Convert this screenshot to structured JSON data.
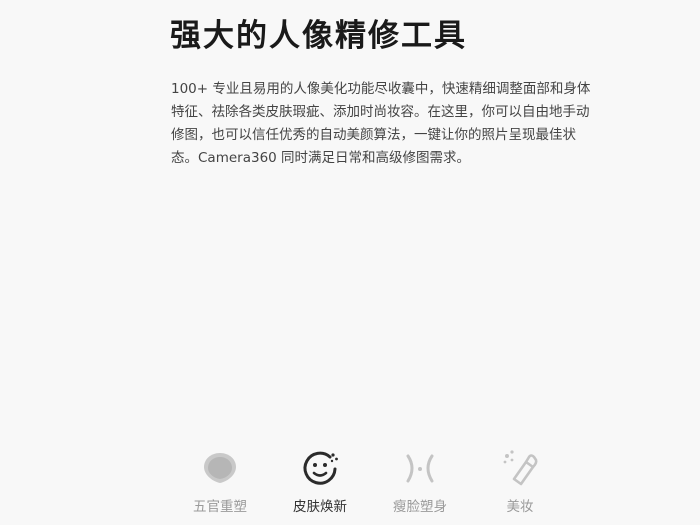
{
  "section": {
    "title": "强大的人像精修工具",
    "description": "100+ 专业且易用的人像美化功能尽收囊中，快速精细调整面部和身体特征、祛除各类皮肤瑕疵、添加时尚妆容。在这里，你可以自由地手动修图，也可以信任优秀的自动美颜算法，一键让你的照片呈现最佳状态。Camera360 同时满足日常和高级修图需求。"
  },
  "tabs": [
    {
      "label": "五官重塑",
      "icon": "face-reshape-icon",
      "active": false
    },
    {
      "label": "皮肤焕新",
      "icon": "skin-smile-icon",
      "active": true
    },
    {
      "label": "瘦脸塑身",
      "icon": "slim-face-icon",
      "active": false
    },
    {
      "label": "美妆",
      "icon": "makeup-lipstick-icon",
      "active": false
    }
  ],
  "colors": {
    "background": "#f8f8f8",
    "title": "#1a1a1a",
    "text": "#444444",
    "active_tab": "#333333",
    "inactive_tab": "#9a9a9a",
    "inactive_icon": "#c4c4c4"
  }
}
